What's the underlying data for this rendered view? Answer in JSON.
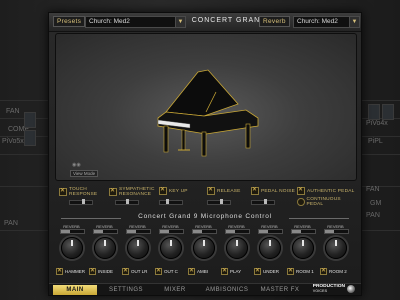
{
  "topbar": {
    "presets_label": "Presets",
    "preset_value": "Church: Med2",
    "title": "CONCERT GRAND",
    "reverb_label": "Reverb",
    "reverb_value": "Church: Med2"
  },
  "display": {
    "view_button": "View Mode",
    "view_icon": "camera-icon"
  },
  "options": [
    {
      "label": "TOUCH RESPONSE",
      "checked": true
    },
    {
      "label": "SYMPATHETIC RESONANCE",
      "checked": true
    },
    {
      "label": "KEY UP",
      "checked": true
    },
    {
      "label": "RELEASE",
      "checked": true
    },
    {
      "label": "PEDAL NOISE",
      "checked": true
    },
    {
      "label": "AUTHENTIC PEDAL",
      "checked": true
    },
    {
      "label": "CONTINUOUS PEDAL",
      "checked": false
    }
  ],
  "mic_control": {
    "title": "Concert Grand 9 Microphone Control",
    "reverb_label": "REVERB",
    "channels": [
      {
        "name": "HAMMER",
        "reverb": 0.4,
        "checked": true
      },
      {
        "name": "INSIDE",
        "reverb": 0.4,
        "checked": true
      },
      {
        "name": "OUT LR",
        "reverb": 0.4,
        "checked": true
      },
      {
        "name": "OUT C",
        "reverb": 0.4,
        "checked": true
      },
      {
        "name": "AMBI",
        "reverb": 0.4,
        "checked": true
      },
      {
        "name": "PLAY",
        "reverb": 0.4,
        "checked": true
      },
      {
        "name": "UNDER",
        "reverb": 0.4,
        "checked": true
      },
      {
        "name": "ROOM 1",
        "reverb": 0.4,
        "checked": true
      },
      {
        "name": "ROOM 2",
        "reverb": 0.4,
        "checked": true
      }
    ]
  },
  "tabs": [
    {
      "label": "MAIN",
      "active": true
    },
    {
      "label": "SETTINGS",
      "active": false
    },
    {
      "label": "MIXER",
      "active": false
    },
    {
      "label": "AMBISONICS",
      "active": false
    },
    {
      "label": "MASTER FX",
      "active": false
    }
  ],
  "logo": {
    "line1": "PRODUCTION",
    "line2": "VOICES"
  },
  "background": {
    "labels": [
      "FAN",
      "COMP",
      "PiVo5x",
      "PAN",
      "PiVo4x",
      "PiPL",
      "FAN",
      "GM",
      "PAN"
    ]
  },
  "colors": {
    "accent": "#e6c15a",
    "panel": "#1c1c1c",
    "tab_active": "#f2dc79"
  }
}
